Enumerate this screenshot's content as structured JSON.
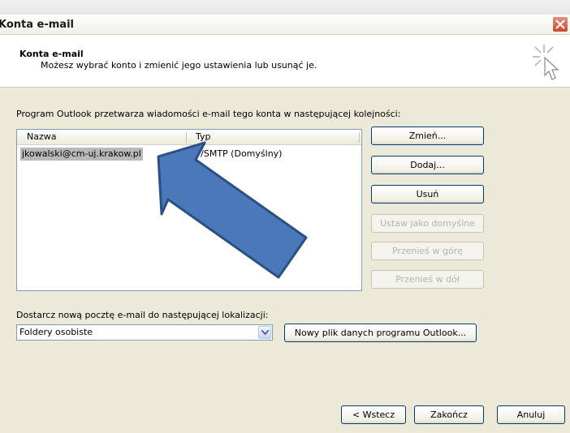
{
  "dialog": {
    "title": "Konta e-mail",
    "header_title": "Konta e-mail",
    "header_subtitle": "Możesz wybrać konto i zmienić jego ustawienia lub usunąć je."
  },
  "accounts": {
    "intro": "Program Outlook przetwarza wiadomości e-mail tego konta w następującej kolejności:",
    "columns": [
      "Nazwa",
      "Typ"
    ],
    "rows": [
      {
        "name": "jkowalski@cm-uj.krakow.pl",
        "type_visible": "AP/SMTP (Domyślny)"
      }
    ]
  },
  "side_buttons": {
    "change": "Zmień...",
    "add": "Dodaj...",
    "remove": "Usuń",
    "set_default": "Ustaw jako domyślne",
    "move_up": "Przenieś w górę",
    "move_down": "Przenieś w dół"
  },
  "delivery": {
    "label": "Dostarcz nową pocztę e-mail do następującej lokalizacji:",
    "selected": "Foldery osobiste",
    "new_file_button": "Nowy plik danych programu Outlook..."
  },
  "footer": {
    "back": "< Wstecz",
    "finish": "Zakończ",
    "cancel": "Anuluj"
  },
  "colors": {
    "window_bg": "#ece9d8",
    "selection": "#b9b9b9",
    "overlay_arrow": "#4a78b8",
    "close_button": "#d65a3c"
  }
}
